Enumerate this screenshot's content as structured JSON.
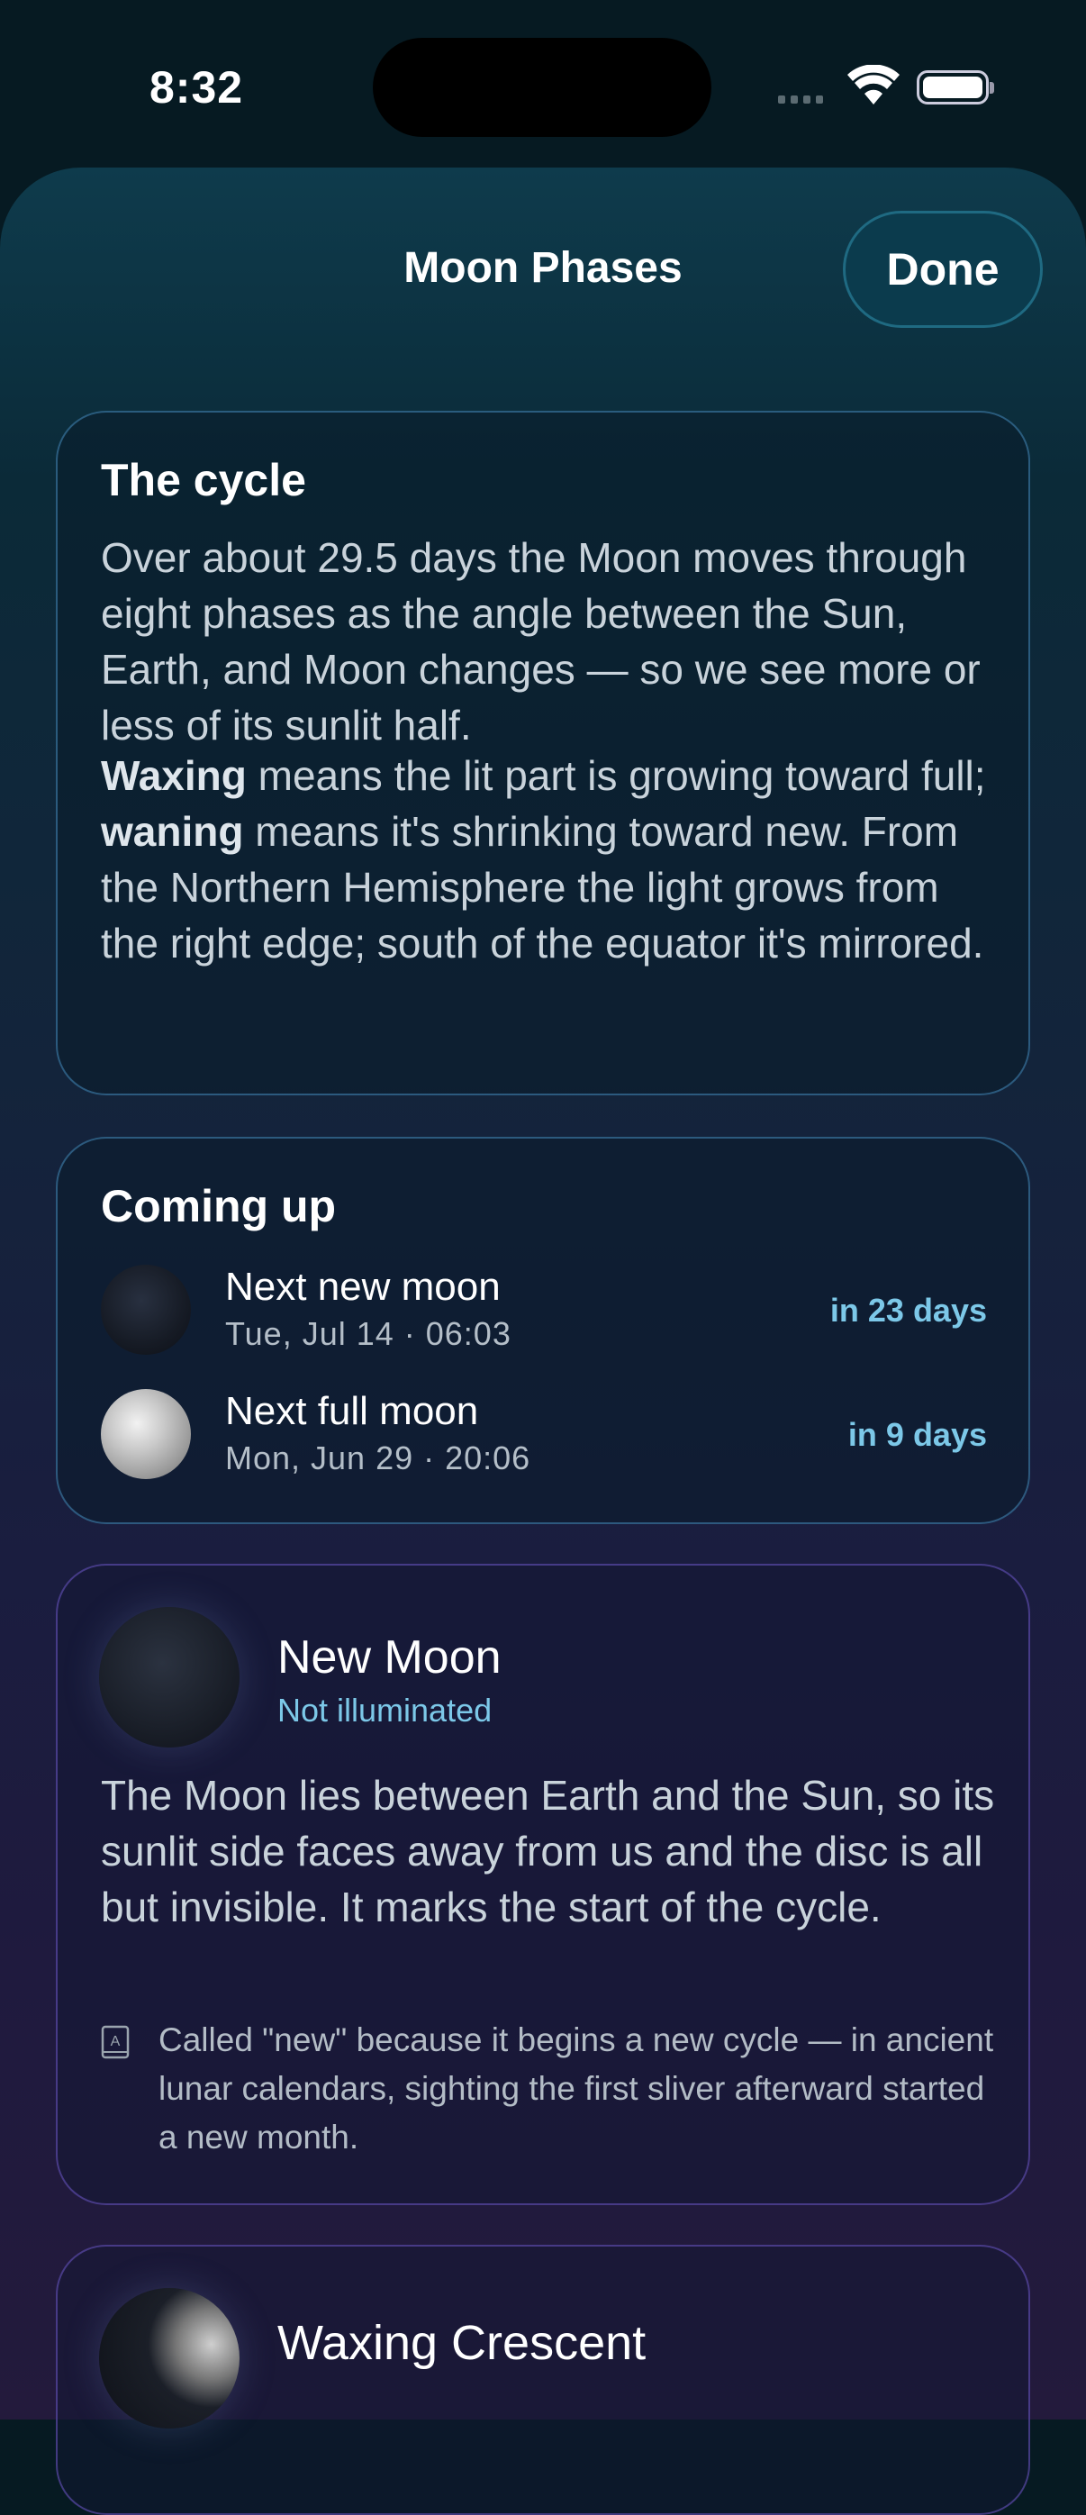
{
  "status_bar": {
    "time": "8:32"
  },
  "sheet": {
    "title": "Moon Phases",
    "done_label": "Done"
  },
  "cycle_card": {
    "title": "The cycle",
    "paragraph1": "Over about 29.5 days the Moon moves through eight phases as the angle between the Sun, Earth, and Moon changes — so we see more or less of its sunlit half.",
    "waxing_word": "Waxing",
    "p2_part1": " means the lit part is growing toward full; ",
    "waning_word": "waning",
    "p2_part2": " means it's shrinking toward new. From the Northern Hemisphere the light grows from the right edge; south of the equator it's mirrored."
  },
  "coming_up": {
    "title": "Coming up",
    "items": [
      {
        "name": "Next new moon",
        "date": "Tue, Jul 14 · 06:03",
        "when": "in 23 days",
        "icon": "new-moon-icon"
      },
      {
        "name": "Next full moon",
        "date": "Mon, Jun 29 · 20:06",
        "when": "in 9 days",
        "icon": "full-moon-icon"
      }
    ]
  },
  "phases": [
    {
      "name": "New Moon",
      "illumination": "Not illuminated",
      "description": "The Moon lies between Earth and the Sun, so its sunlit side faces away from us and the disc is all but invisible. It marks the start of the cycle.",
      "note": "Called \"new\" because it begins a new cycle — in ancient lunar calendars, sighting the first sliver afterward started a new month.",
      "note_icon": "dictionary-icon"
    },
    {
      "name": "Waxing Crescent"
    }
  ],
  "colors": {
    "accent": "#7cc8e8",
    "done_bg": "#0b3b4d"
  }
}
